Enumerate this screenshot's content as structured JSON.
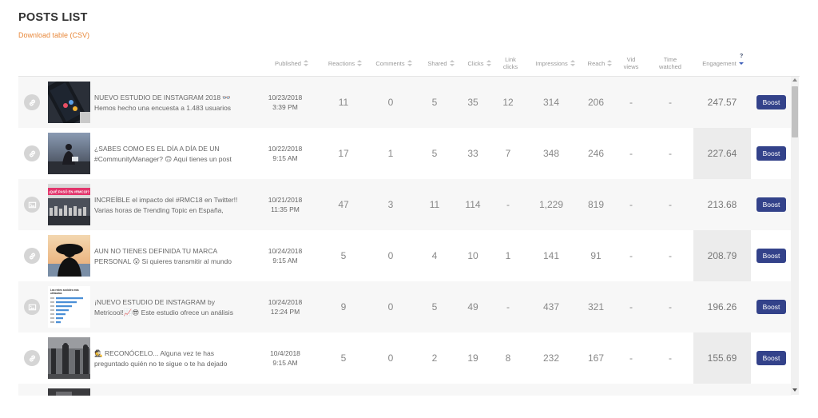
{
  "page": {
    "title": "POSTS LIST",
    "download_label": "Download table (CSV)"
  },
  "columns": {
    "published": "Published",
    "reactions": "Reactions",
    "comments": "Comments",
    "shared": "Shared",
    "clicks": "Clicks",
    "link_clicks_1": "Link",
    "link_clicks_2": "clicks",
    "impressions": "Impressions",
    "reach": "Reach",
    "vid_views_1": "Vid",
    "vid_views_2": "views",
    "time_watched_1": "Time",
    "time_watched_2": "watched",
    "engagement": "Engagement",
    "engagement_help": "?"
  },
  "boost_label": "Boost",
  "posts": [
    {
      "type_icon": "link-icon",
      "line1": "NUEVO ESTUDIO DE INSTAGRAM 2018 👓",
      "line2": "Hemos hecho una encuesta a 1.483 usuarios",
      "date": "10/23/2018",
      "time": "3:39 PM",
      "reactions": "11",
      "comments": "0",
      "shared": "5",
      "clicks": "35",
      "link_clicks": "12",
      "impressions": "314",
      "reach": "206",
      "vid_views": "-",
      "time_watched": "-",
      "engagement": "247.57"
    },
    {
      "type_icon": "link-icon",
      "line1": "¿SABES COMO ES EL DÍA A DÍA DE UN",
      "line2": "#CommunityManager? 🙃 Aquí tienes un post",
      "date": "10/22/2018",
      "time": "9:15 AM",
      "reactions": "17",
      "comments": "1",
      "shared": "5",
      "clicks": "33",
      "link_clicks": "7",
      "impressions": "348",
      "reach": "246",
      "vid_views": "-",
      "time_watched": "-",
      "engagement": "227.64"
    },
    {
      "type_icon": "image-icon",
      "line1": "INCREÍBLE el impacto del #RMC18 en Twitter!!",
      "line2": "Varias horas de Trending Topic en España,",
      "date": "10/21/2018",
      "time": "11:35 PM",
      "reactions": "47",
      "comments": "3",
      "shared": "11",
      "clicks": "114",
      "link_clicks": "-",
      "impressions": "1,229",
      "reach": "819",
      "vid_views": "-",
      "time_watched": "-",
      "engagement": "213.68"
    },
    {
      "type_icon": "link-icon",
      "line1": "AUN NO TIENES DEFINIDA TU MARCA",
      "line2": "PERSONAL 😲 Si quieres transmitir al mundo",
      "date": "10/24/2018",
      "time": "9:15 AM",
      "reactions": "5",
      "comments": "0",
      "shared": "4",
      "clicks": "10",
      "link_clicks": "1",
      "impressions": "141",
      "reach": "91",
      "vid_views": "-",
      "time_watched": "-",
      "engagement": "208.79"
    },
    {
      "type_icon": "image-icon",
      "line1": "¡NUEVO ESTUDIO DE INSTAGRAM by",
      "line2": "Metricool!📈😎 Este estudio ofrece un análisis",
      "date": "10/24/2018",
      "time": "12:24 PM",
      "reactions": "9",
      "comments": "0",
      "shared": "5",
      "clicks": "49",
      "link_clicks": "-",
      "impressions": "437",
      "reach": "321",
      "vid_views": "-",
      "time_watched": "-",
      "engagement": "196.26"
    },
    {
      "type_icon": "link-icon",
      "line1": "🕵 RECONÓCELO... Alguna vez te has",
      "line2": "preguntado quién no te sigue o te ha dejado",
      "date": "10/4/2018",
      "time": "9:15 AM",
      "reactions": "5",
      "comments": "0",
      "shared": "2",
      "clicks": "19",
      "link_clicks": "8",
      "impressions": "232",
      "reach": "167",
      "vid_views": "-",
      "time_watched": "-",
      "engagement": "155.69"
    }
  ],
  "thumbs": {
    "p3_banner": "¡QUÉ PASÓ EN #RMC18?",
    "p5_title_1": "Las redes sociales más",
    "p5_title_2": "utilizadas"
  },
  "colors": {
    "accent_orange": "#e8883a",
    "boost_blue": "#33428a",
    "engagement_bg": "#ececec"
  }
}
